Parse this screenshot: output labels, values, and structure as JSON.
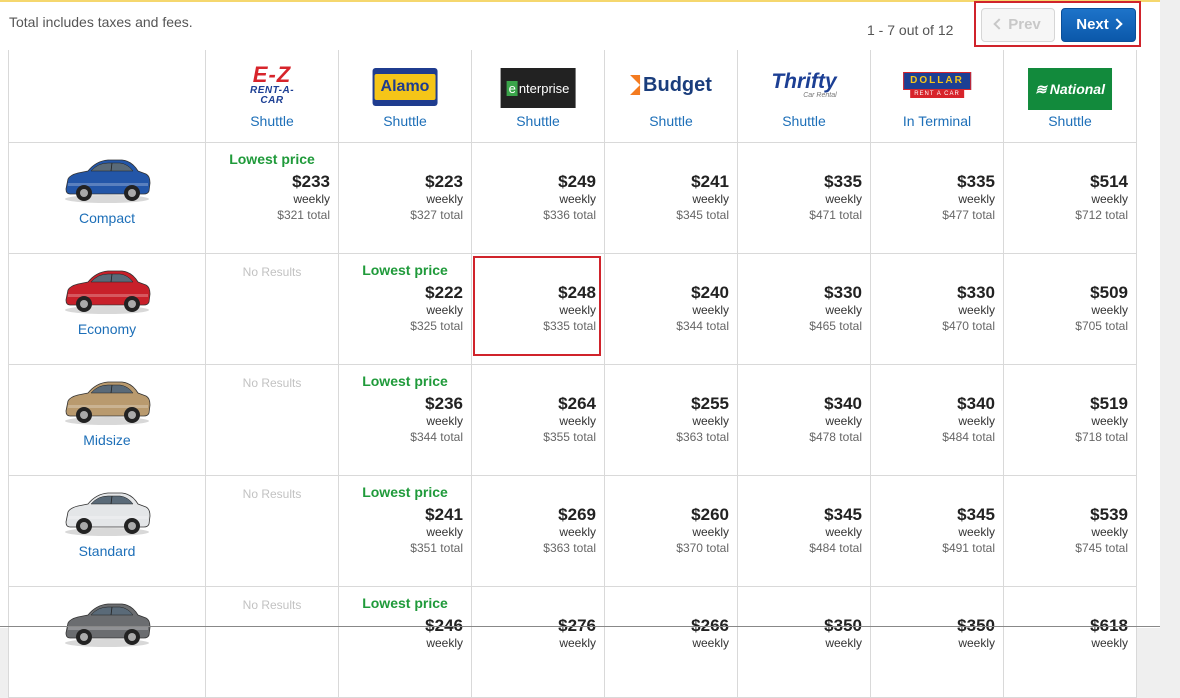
{
  "header": {
    "note": "Total includes taxes and fees.",
    "pager_count": "1 - 7 out of 12",
    "prev_label": "Prev",
    "next_label": "Next"
  },
  "brands": [
    {
      "id": "ez",
      "logo_text": [
        "E-Z",
        "RENT-A-CAR"
      ],
      "location": "Shuttle"
    },
    {
      "id": "alamo",
      "logo_text": [
        "Alamo"
      ],
      "location": "Shuttle"
    },
    {
      "id": "enterprise",
      "logo_text": [
        "e",
        "nterprise"
      ],
      "location": "Shuttle"
    },
    {
      "id": "budget",
      "logo_text": [
        "Budget"
      ],
      "location": "Shuttle"
    },
    {
      "id": "thrifty",
      "logo_text": [
        "Thrifty",
        "Car Rental"
      ],
      "location": "Shuttle"
    },
    {
      "id": "dollar",
      "logo_text": [
        "DOLLAR",
        "RENT A CAR"
      ],
      "location": "In Terminal"
    },
    {
      "id": "national",
      "logo_text": [
        "National"
      ],
      "location": "Shuttle"
    }
  ],
  "labels": {
    "lowest_price": "Lowest price",
    "no_results": "No Results",
    "weekly": "weekly"
  },
  "colors": {
    "link_blue": "#1d6fb8",
    "lowest_green": "#1f9a3a",
    "highlight_red": "#d0232b",
    "next_button": "#1564b8"
  },
  "rows": [
    {
      "car_class": "Compact",
      "car_color": "#2356a8",
      "cells": [
        {
          "lowest": true,
          "price": "$233",
          "total": "$321 total"
        },
        {
          "price": "$223",
          "total": "$327 total"
        },
        {
          "price": "$249",
          "total": "$336 total"
        },
        {
          "price": "$241",
          "total": "$345 total"
        },
        {
          "price": "$335",
          "total": "$471 total"
        },
        {
          "price": "$335",
          "total": "$477 total"
        },
        {
          "price": "$514",
          "total": "$712 total"
        }
      ]
    },
    {
      "car_class": "Economy",
      "car_color": "#c8202a",
      "cells": [
        {
          "no_results": true
        },
        {
          "lowest": true,
          "price": "$222",
          "total": "$325 total"
        },
        {
          "price": "$248",
          "total": "$335 total",
          "highlighted": true
        },
        {
          "price": "$240",
          "total": "$344 total"
        },
        {
          "price": "$330",
          "total": "$465 total"
        },
        {
          "price": "$330",
          "total": "$470 total"
        },
        {
          "price": "$509",
          "total": "$705 total"
        }
      ]
    },
    {
      "car_class": "Midsize",
      "car_color": "#b99a6e",
      "cells": [
        {
          "no_results": true
        },
        {
          "lowest": true,
          "price": "$236",
          "total": "$344 total"
        },
        {
          "price": "$264",
          "total": "$355 total"
        },
        {
          "price": "$255",
          "total": "$363 total"
        },
        {
          "price": "$340",
          "total": "$478 total"
        },
        {
          "price": "$340",
          "total": "$484 total"
        },
        {
          "price": "$519",
          "total": "$718 total"
        }
      ]
    },
    {
      "car_class": "Standard",
      "car_color": "#e4e6e8",
      "cells": [
        {
          "no_results": true
        },
        {
          "lowest": true,
          "price": "$241",
          "total": "$351 total"
        },
        {
          "price": "$269",
          "total": "$363 total"
        },
        {
          "price": "$260",
          "total": "$370 total"
        },
        {
          "price": "$345",
          "total": "$484 total"
        },
        {
          "price": "$345",
          "total": "$491 total"
        },
        {
          "price": "$539",
          "total": "$745 total"
        }
      ]
    },
    {
      "car_class": "",
      "car_color": "#6b6d70",
      "cells": [
        {
          "no_results": true
        },
        {
          "lowest": true,
          "price": "$246",
          "total": ""
        },
        {
          "price": "$276",
          "total": ""
        },
        {
          "price": "$266",
          "total": ""
        },
        {
          "price": "$350",
          "total": ""
        },
        {
          "price": "$350",
          "total": ""
        },
        {
          "price": "$618",
          "total": ""
        }
      ]
    }
  ]
}
